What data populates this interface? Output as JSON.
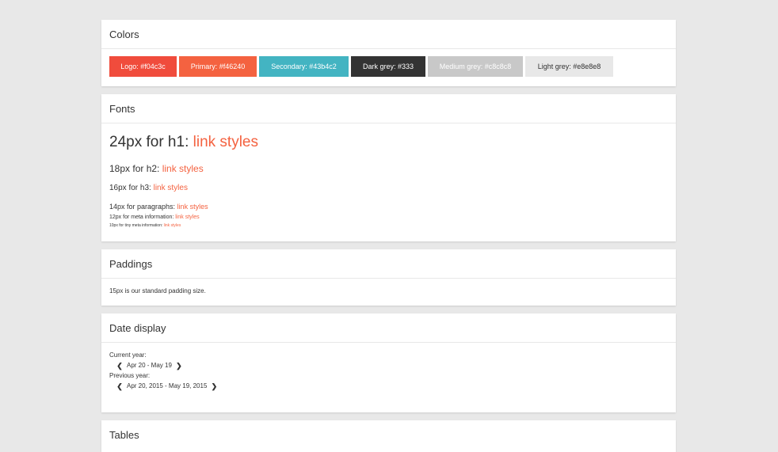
{
  "colors": {
    "title": "Colors",
    "swatches": [
      {
        "label": "Logo: #f04c3c",
        "bg": "#f04c3c",
        "fg": "#ffffff"
      },
      {
        "label": "Primary: #f46240",
        "bg": "#f46240",
        "fg": "#ffffff"
      },
      {
        "label": "Secondary: #43b4c2",
        "bg": "#43b4c2",
        "fg": "#ffffff"
      },
      {
        "label": "Dark grey: #333",
        "bg": "#333333",
        "fg": "#ffffff"
      },
      {
        "label": "Medium grey: #c8c8c8",
        "bg": "#c8c8c8",
        "fg": "#ffffff"
      },
      {
        "label": "Light grey: #e8e8e8",
        "bg": "#e8e8e8",
        "fg": "#333333"
      }
    ]
  },
  "fonts": {
    "title": "Fonts",
    "h1_text": "24px for h1: ",
    "h2_text": "18px for h2: ",
    "h3_text": "16px for h3: ",
    "p_text": "14px for paragraphs: ",
    "meta_text": "12px for meta information: ",
    "tiny_text": "10px for tiny meta information: ",
    "link_label": "link styles"
  },
  "paddings": {
    "title": "Paddings",
    "text": "15px is our standard padding size."
  },
  "date_display": {
    "title": "Date display",
    "current_label": "Current year:",
    "current_range": "Apr 20 - May 19",
    "previous_label": "Previous year:",
    "previous_range": "Apr 20, 2015 - May 19, 2015"
  },
  "tables": {
    "title": "Tables"
  },
  "accent_color": "#f46240"
}
